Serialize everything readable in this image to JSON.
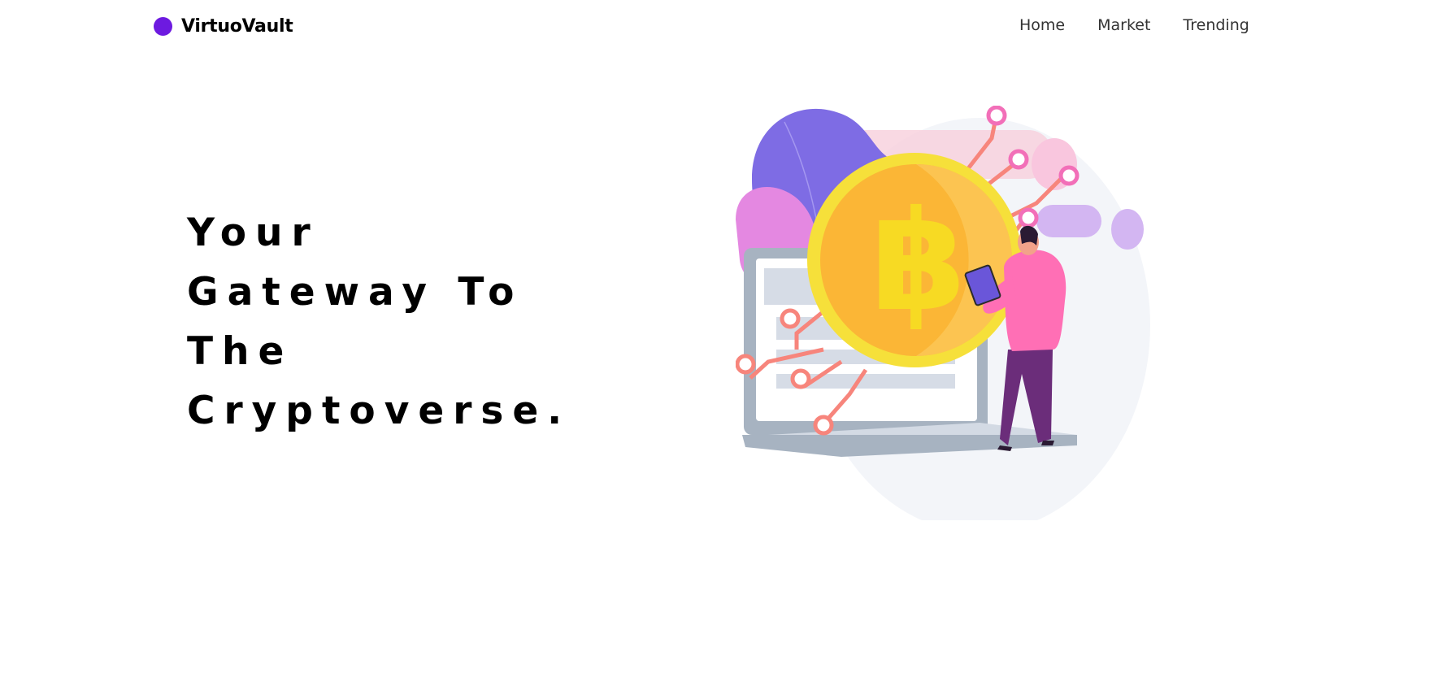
{
  "brand": {
    "name": "VirtuoVault",
    "dot_color": "#6d1ae0"
  },
  "nav": {
    "items": [
      {
        "label": "Home"
      },
      {
        "label": "Market"
      },
      {
        "label": "Trending"
      }
    ]
  },
  "hero": {
    "lines": [
      "Your",
      "Gateway To",
      "The",
      "Cryptoverse."
    ]
  },
  "illustration": {
    "coin_symbol": "฿",
    "colors": {
      "coin": "#fbb636",
      "purple_blob": "#7e6ce4",
      "pink_person": "#ff6fb5",
      "circuit": "#f7857c",
      "laptop": "#a7b3c1"
    }
  }
}
